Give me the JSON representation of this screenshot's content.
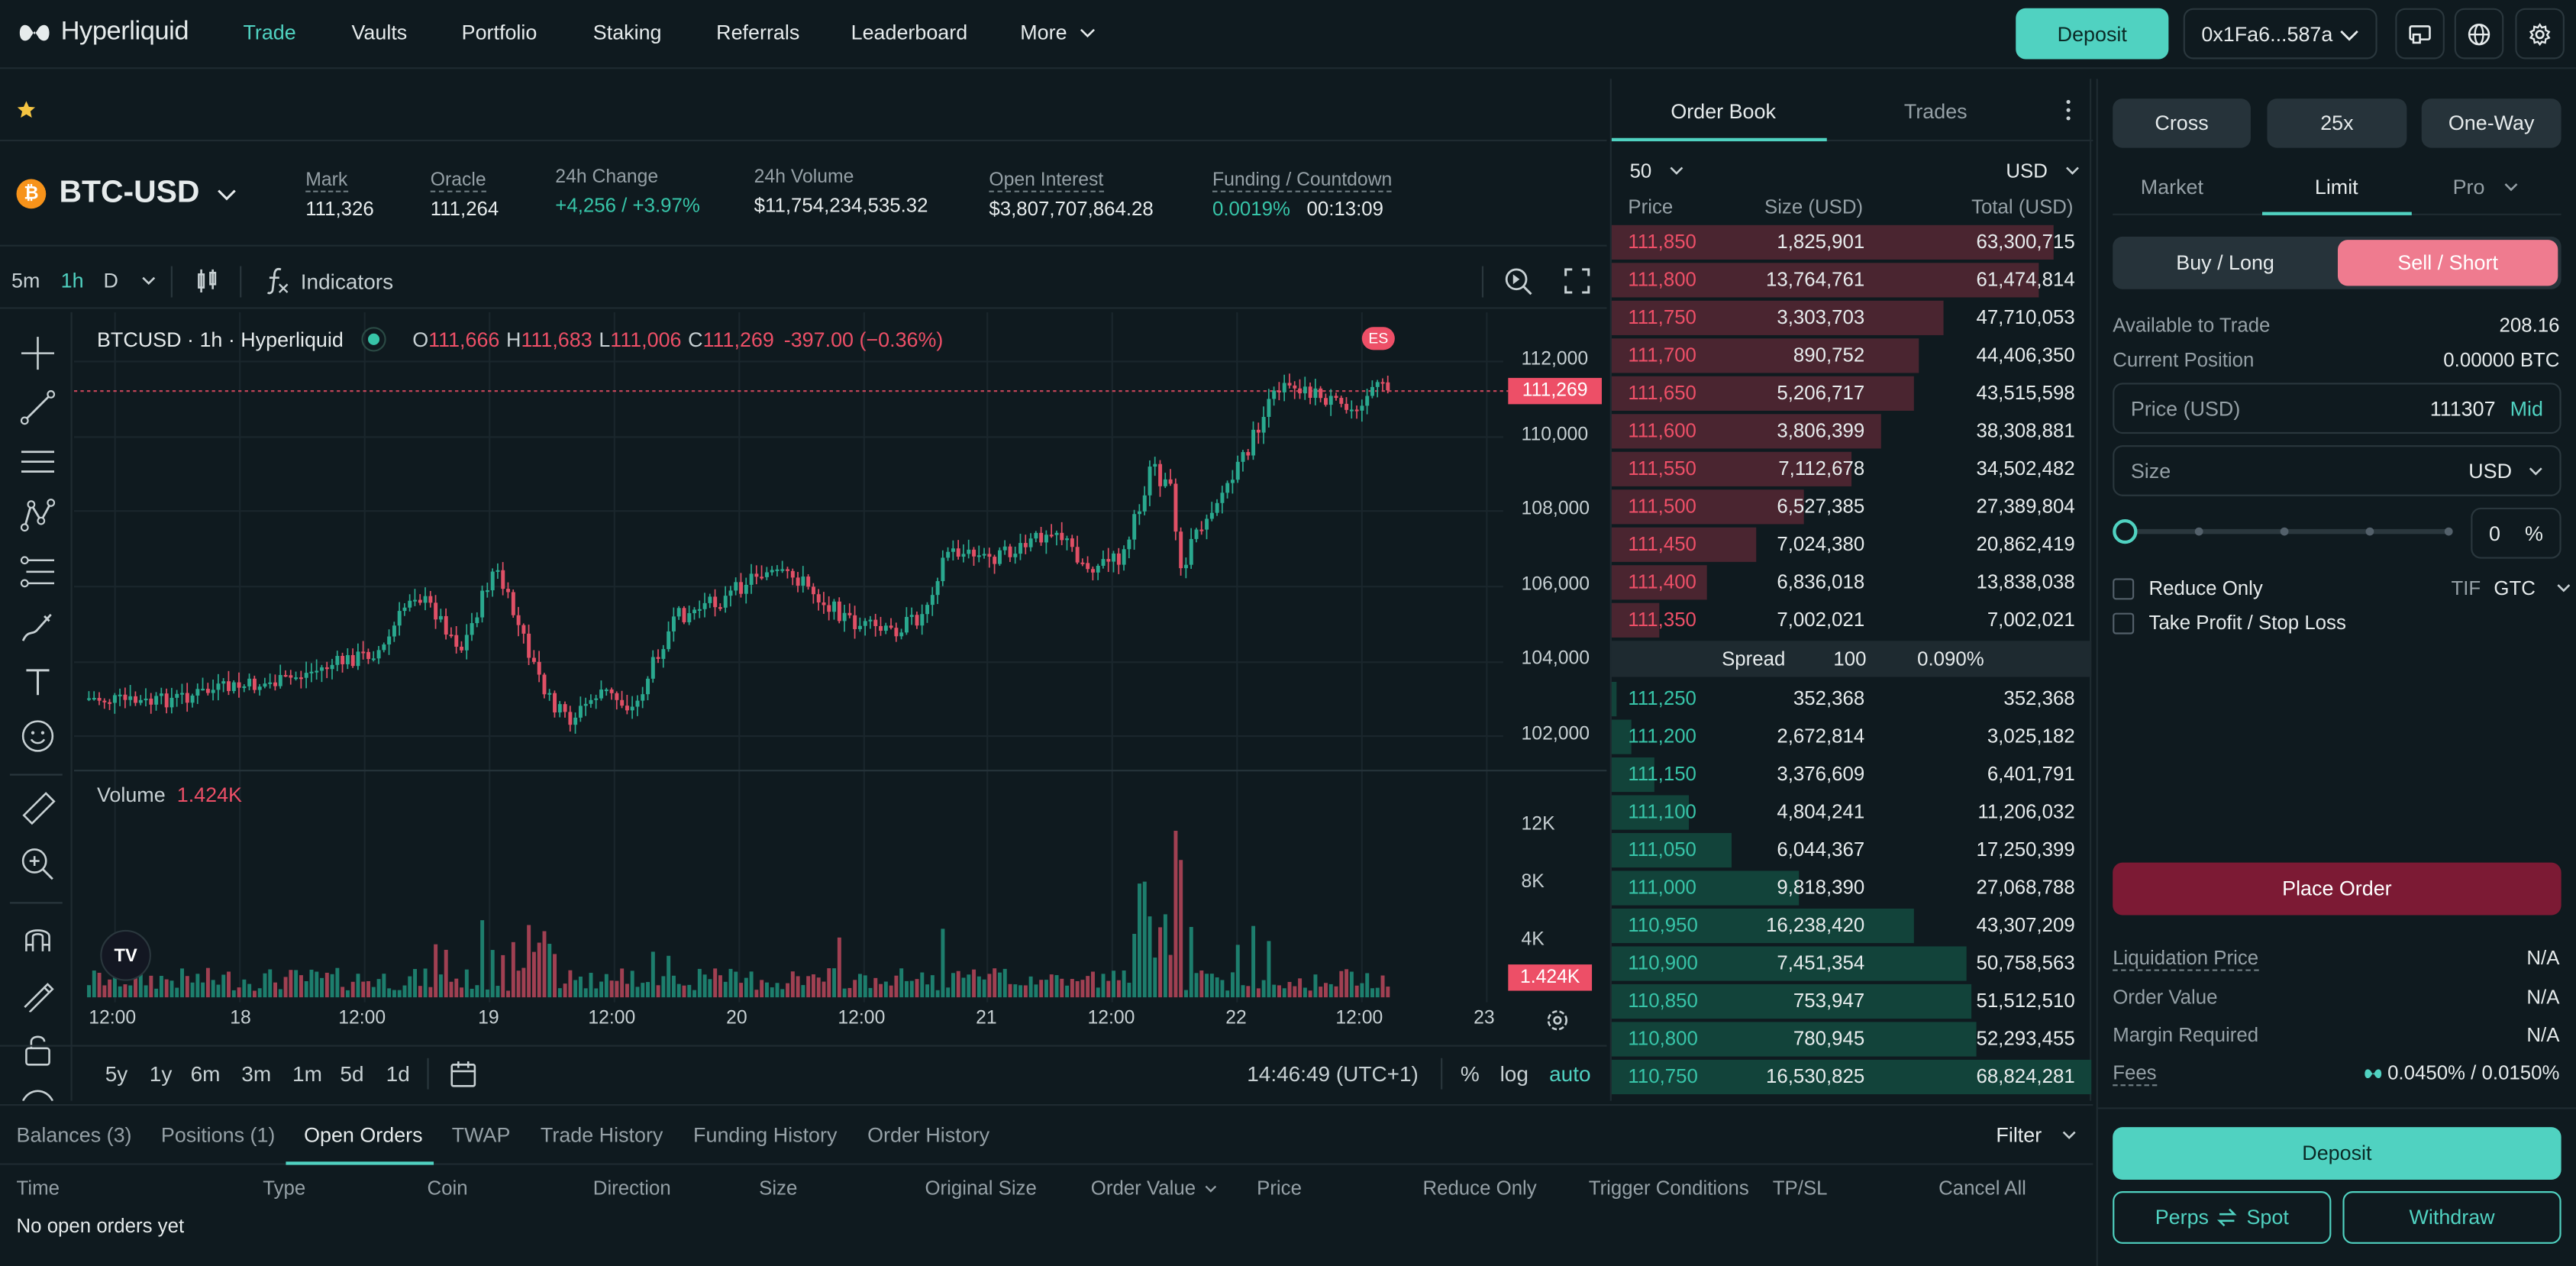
{
  "brand": {
    "name": "Hyperliquid"
  },
  "nav": {
    "items": [
      {
        "label": "Trade"
      },
      {
        "label": "Vaults"
      },
      {
        "label": "Portfolio"
      },
      {
        "label": "Staking"
      },
      {
        "label": "Referrals"
      },
      {
        "label": "Leaderboard"
      },
      {
        "label": "More"
      }
    ],
    "deposit": "Deposit",
    "wallet": "0x1Fa6...587a"
  },
  "market": {
    "symbol": "BTC-USD",
    "coin_badge": "₿",
    "stats": [
      {
        "label": "Mark",
        "value": "111,326"
      },
      {
        "label": "Oracle",
        "value": "111,264"
      },
      {
        "label": "24h Change",
        "value": "+4,256 / +3.97%"
      },
      {
        "label": "24h Volume",
        "value": "$11,754,234,535.32"
      },
      {
        "label": "Open Interest",
        "value": "$3,807,707,864.28"
      },
      {
        "label": "Funding / Countdown",
        "value": "0.0019%",
        "value2": "00:13:09"
      }
    ]
  },
  "chart_toolbar": {
    "intervals": [
      "5m",
      "1h",
      "D"
    ],
    "indicators": "Indicators"
  },
  "chart": {
    "legend": "BTCUSD · 1h · Hyperliquid",
    "o_label": "O",
    "o": "111,666",
    "h_label": "H",
    "h": "111,683",
    "l_label": "L",
    "l": "111,006",
    "c_label": "C",
    "c": "111,269",
    "change": "-397.00 (−0.36%)",
    "price_ticks": [
      "112,000",
      "110,000",
      "108,000",
      "106,000",
      "104,000",
      "102,000"
    ],
    "last_price": "111,269",
    "volume_label": "Volume",
    "volume_value": "1.424K",
    "volume_ticks": [
      "12K",
      "8K",
      "4K"
    ],
    "volume_last": "1.424K",
    "time_ticks": [
      "12:00",
      "18",
      "12:00",
      "19",
      "12:00",
      "20",
      "12:00",
      "21",
      "12:00",
      "22",
      "12:00",
      "23"
    ],
    "es_badge": "ES",
    "tv_logo": "TV"
  },
  "chart_bottom": {
    "ranges": [
      "5y",
      "1y",
      "6m",
      "3m",
      "1m",
      "5d",
      "1d"
    ],
    "clock": "14:46:49 (UTC+1)",
    "pct": "%",
    "log": "log",
    "auto": "auto"
  },
  "bottom_panel": {
    "tabs": [
      "Balances (3)",
      "Positions (1)",
      "Open Orders",
      "TWAP",
      "Trade History",
      "Funding History",
      "Order History"
    ],
    "filter": "Filter",
    "columns": [
      "Time",
      "Type",
      "Coin",
      "Direction",
      "Size",
      "Original Size",
      "Order Value",
      "Price",
      "Reduce Only",
      "Trigger Conditions",
      "TP/SL",
      "Cancel All"
    ],
    "empty": "No open orders yet"
  },
  "orderbook": {
    "tabs": [
      "Order Book",
      "Trades"
    ],
    "depth": "50",
    "unit": "USD",
    "headers": [
      "Price",
      "Size (USD)",
      "Total (USD)"
    ],
    "asks": [
      {
        "price": "111,850",
        "size": "1,825,901",
        "total": "63,300,715",
        "depth": 0.92
      },
      {
        "price": "111,800",
        "size": "13,764,761",
        "total": "61,474,814",
        "depth": 0.89
      },
      {
        "price": "111,750",
        "size": "3,303,703",
        "total": "47,710,053",
        "depth": 0.69
      },
      {
        "price": "111,700",
        "size": "890,752",
        "total": "44,406,350",
        "depth": 0.64
      },
      {
        "price": "111,650",
        "size": "5,206,717",
        "total": "43,515,598",
        "depth": 0.63
      },
      {
        "price": "111,600",
        "size": "3,806,399",
        "total": "38,308,881",
        "depth": 0.56
      },
      {
        "price": "111,550",
        "size": "7,112,678",
        "total": "34,502,482",
        "depth": 0.5
      },
      {
        "price": "111,500",
        "size": "6,527,385",
        "total": "27,389,804",
        "depth": 0.4
      },
      {
        "price": "111,450",
        "size": "7,024,380",
        "total": "20,862,419",
        "depth": 0.3
      },
      {
        "price": "111,400",
        "size": "6,836,018",
        "total": "13,838,038",
        "depth": 0.2
      },
      {
        "price": "111,350",
        "size": "7,002,021",
        "total": "7,002,021",
        "depth": 0.1
      }
    ],
    "spread": {
      "label": "Spread",
      "value": "100",
      "pct": "0.090%"
    },
    "bids": [
      {
        "price": "111,250",
        "size": "352,368",
        "total": "352,368",
        "depth": 0.01
      },
      {
        "price": "111,200",
        "size": "2,672,814",
        "total": "3,025,182",
        "depth": 0.04
      },
      {
        "price": "111,150",
        "size": "3,376,609",
        "total": "6,401,791",
        "depth": 0.09
      },
      {
        "price": "111,100",
        "size": "4,804,241",
        "total": "11,206,032",
        "depth": 0.16
      },
      {
        "price": "111,050",
        "size": "6,044,367",
        "total": "17,250,399",
        "depth": 0.25
      },
      {
        "price": "111,000",
        "size": "9,818,390",
        "total": "27,068,788",
        "depth": 0.39
      },
      {
        "price": "110,950",
        "size": "16,238,420",
        "total": "43,307,209",
        "depth": 0.63
      },
      {
        "price": "110,900",
        "size": "7,451,354",
        "total": "50,758,563",
        "depth": 0.74
      },
      {
        "price": "110,850",
        "size": "753,947",
        "total": "51,512,510",
        "depth": 0.75
      },
      {
        "price": "110,800",
        "size": "780,945",
        "total": "52,293,455",
        "depth": 0.76
      },
      {
        "price": "110,750",
        "size": "16,530,825",
        "total": "68,824,281",
        "depth": 1.0
      }
    ]
  },
  "order_form": {
    "margin_mode": "Cross",
    "leverage": "25x",
    "position_mode": "One-Way",
    "order_types": [
      "Market",
      "Limit",
      "Pro"
    ],
    "buy": "Buy / Long",
    "sell": "Sell / Short",
    "available_label": "Available to Trade",
    "available_value": "208.16",
    "position_label": "Current Position",
    "position_value": "0.00000 BTC",
    "price_label": "Price (USD)",
    "price_value": "111307",
    "mid": "Mid",
    "size_label": "Size",
    "size_unit": "USD",
    "size_pct": "0",
    "pct_sign": "%",
    "slider_value": 0,
    "reduce_only": "Reduce Only",
    "tif_label": "TIF",
    "tif_value": "GTC",
    "tpsl": "Take Profit / Stop Loss",
    "place_order": "Place Order",
    "info": [
      {
        "label": "Liquidation Price",
        "value": "N/A"
      },
      {
        "label": "Order Value",
        "value": "N/A"
      },
      {
        "label": "Margin Required",
        "value": "N/A"
      },
      {
        "label": "Fees",
        "value": "0.0450% / 0.0150%"
      }
    ],
    "deposit": "Deposit",
    "perps_spot_a": "Perps",
    "perps_spot_b": "Spot",
    "withdraw": "Withdraw"
  },
  "colors": {
    "accent": "#50d2c1",
    "bid": "#37c4a8",
    "ask": "#ed4f67",
    "bg": "#0f1a1f",
    "panel": "#0f1a1f"
  }
}
